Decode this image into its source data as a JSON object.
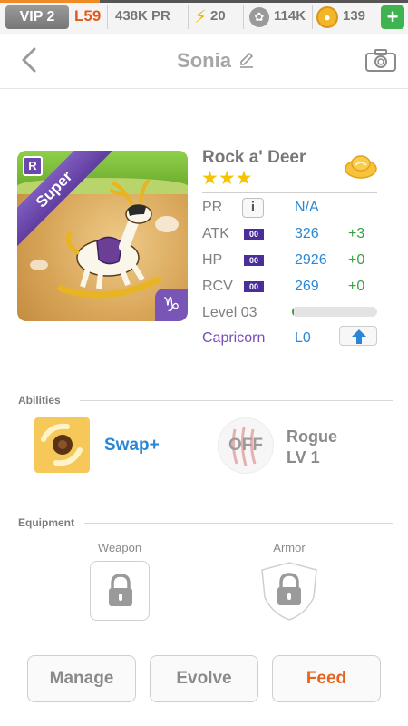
{
  "statusbar": {
    "vip": "VIP 2",
    "level": "L59",
    "pr": "438K PR",
    "energy": "20",
    "paws": "114K",
    "coins": "139",
    "add": "+"
  },
  "header": {
    "title": "Sonia"
  },
  "monster": {
    "name": "Rock a' Deer",
    "stars": "★★★",
    "ribbon": "Super",
    "rarity_badge": "R",
    "zodiac_glyph": "♑",
    "stats": {
      "pr_label": "PR",
      "pr_info": "i",
      "pr_value": "N/A",
      "atk_label": "ATK",
      "atk_badge": "00",
      "atk_value": "326",
      "atk_bonus": "+3",
      "hp_label": "HP",
      "hp_badge": "00",
      "hp_value": "2926",
      "hp_bonus": "+0",
      "rcv_label": "RCV",
      "rcv_badge": "00",
      "rcv_value": "269",
      "rcv_bonus": "+0",
      "level_label": "Level 03",
      "level_progress": 0.02,
      "zodiac_name": "Capricorn",
      "zodiac_level": "L0"
    }
  },
  "abilities": {
    "label": "Abilities",
    "skill_name": "Swap+",
    "off_label": "OFF",
    "leader_name": "Rogue",
    "leader_level": "LV 1"
  },
  "equipment": {
    "label": "Equipment",
    "weapon_label": "Weapon",
    "armor_label": "Armor"
  },
  "actions": {
    "manage": "Manage",
    "evolve": "Evolve",
    "feed": "Feed"
  },
  "colors": {
    "accent_blue": "#2a86d6",
    "bonus_green": "#3aa042",
    "feed_orange": "#e8631e",
    "zodiac_purple": "#7a4fb5"
  }
}
